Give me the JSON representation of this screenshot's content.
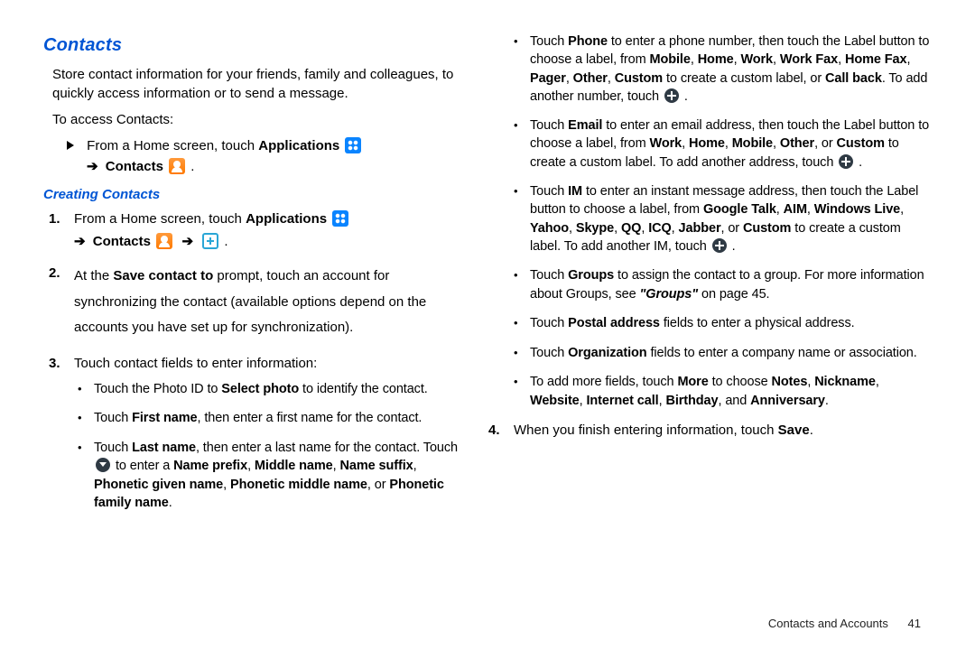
{
  "heading": "Contacts",
  "intro": "Store contact information for your friends, family and colleagues, to quickly access information or to send a message.",
  "access_lead": "To access Contacts:",
  "access_line_a": "From a Home screen, touch ",
  "applications_word": "Applications",
  "contacts_word": "Contacts",
  "arrow": "➔",
  "subheading": "Creating Contacts",
  "step1_a": "From a Home screen, touch ",
  "step2": "At the <b>Save contact to</b> prompt, touch an account for synchronizing the contact (available options depend on the accounts you have set up for synchronization).",
  "step3": "Touch contact fields to enter information:",
  "b_photo": "Touch the Photo ID to <b>Select photo</b> to identify the contact.",
  "b_first": "Touch <b>First name</b>, then enter a first name for the contact.",
  "b_last": "Touch <b>Last name</b>, then enter a last name for the contact. Touch",
  "b_last_tail": " to enter a <b>Name prefix</b>, <b>Middle name</b>, <b>Name suffix</b>, <b>Phonetic given name</b>, <b>Phonetic middle name</b>, or <b>Phonetic family name</b>.",
  "b_phone_a": "Touch <b>Phone</b> to enter a phone number, then touch the Label button to choose a label, from <b>Mobile</b>, <b>Home</b>, <b>Work</b>, <b>Work Fax</b>, <b>Home Fax</b>, <b>Pager</b>, <b>Other</b>, <b>Custom</b> to create a custom label, or <b>Call back</b>. To add another number, touch ",
  "b_email_a": "Touch <b>Email</b> to enter an email address, then touch the Label button to choose a label, from <b>Work</b>, <b>Home</b>, <b>Mobile</b>, <b>Other</b>, or <b>Custom</b> to create a custom label. To add another address, touch ",
  "b_im_a": "Touch <b>IM</b> to enter an instant message address, then touch the Label button to choose a label, from <b>Google Talk</b>, <b>AIM</b>, <b>Windows Live</b>, <b>Yahoo</b>, <b>Skype</b>, <b>QQ</b>, <b>ICQ</b>, <b>Jabber</b>, or <b>Custom</b> to create a custom label. To add another IM, touch ",
  "b_groups": "Touch <b>Groups</b> to assign the contact to a group. For more information about Groups, see <i class='link'>\"Groups\"</i> on page 45.",
  "b_postal": "Touch <b>Postal address</b> fields to enter a physical address.",
  "b_org": "Touch <b>Organization</b> fields to enter a company name or association.",
  "b_more": "To add more fields, touch <b>More</b> to choose <b>Notes</b>, <b>Nickname</b>, <b>Website</b>, <b>Internet call</b>, <b>Birthday</b>, and <b>Anniversary</b>.",
  "step4": "When you finish entering information, touch <b>Save</b>.",
  "footer_section": "Contacts and Accounts",
  "footer_page": "41"
}
